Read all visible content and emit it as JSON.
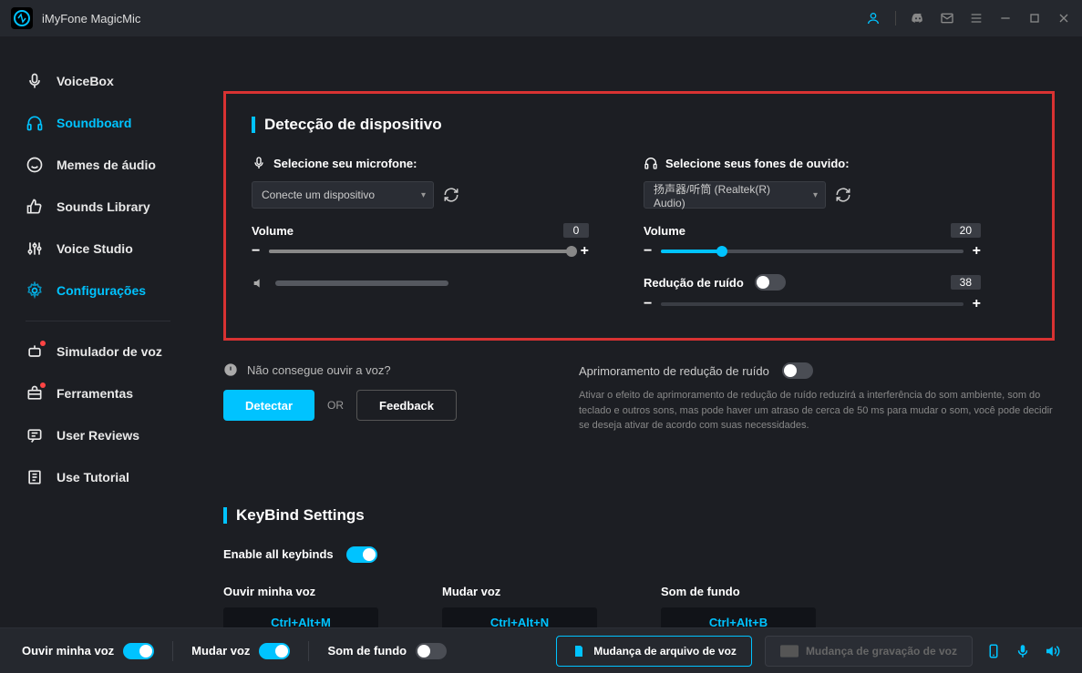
{
  "app_title": "iMyFone MagicMic",
  "sidebar": {
    "items": [
      {
        "label": "VoiceBox"
      },
      {
        "label": "Soundboard"
      },
      {
        "label": "Memes de áudio"
      },
      {
        "label": "Sounds Library"
      },
      {
        "label": "Voice Studio"
      },
      {
        "label": "Configurações"
      },
      {
        "label": "Simulador de voz"
      },
      {
        "label": "Ferramentas"
      },
      {
        "label": "User Reviews"
      },
      {
        "label": "Use Tutorial"
      }
    ]
  },
  "device_detection": {
    "title": "Detecção de dispositivo",
    "mic_label": "Selecione seu microfone:",
    "mic_selected": "Conecte um dispositivo",
    "mic_volume_label": "Volume",
    "mic_volume": "0",
    "hp_label": "Selecione seus fones de ouvido:",
    "hp_selected": "扬声器/听筒 (Realtek(R) Audio)",
    "hp_volume_label": "Volume",
    "hp_volume": "20",
    "noise_label": "Redução de ruído",
    "noise_value": "38"
  },
  "detect_help": {
    "warn": "Não consegue ouvir a voz?",
    "detect_btn": "Detectar",
    "or": "OR",
    "feedback_btn": "Feedback"
  },
  "noise_enh": {
    "title": "Aprimoramento de redução de ruído",
    "desc": "Ativar o efeito de aprimoramento de redução de ruído reduzirá a interferência do som ambiente, som do teclado e outros sons, mas pode haver um atraso de cerca de 50 ms para mudar o som, você pode decidir se deseja ativar de acordo com suas necessidades."
  },
  "keybind": {
    "title": "KeyBind Settings",
    "enable_label": "Enable all keybinds",
    "items": [
      {
        "label": "Ouvir minha voz",
        "combo": "Ctrl+Alt+M"
      },
      {
        "label": "Mudar voz",
        "combo": "Ctrl+Alt+N"
      },
      {
        "label": "Som de fundo",
        "combo": "Ctrl+Alt+B"
      }
    ]
  },
  "bottombar": {
    "hear_voice": "Ouvir minha voz",
    "change_voice": "Mudar voz",
    "bg_sound": "Som de fundo",
    "file_change": "Mudança de arquivo de voz",
    "rec_change": "Mudança de gravação de voz"
  }
}
